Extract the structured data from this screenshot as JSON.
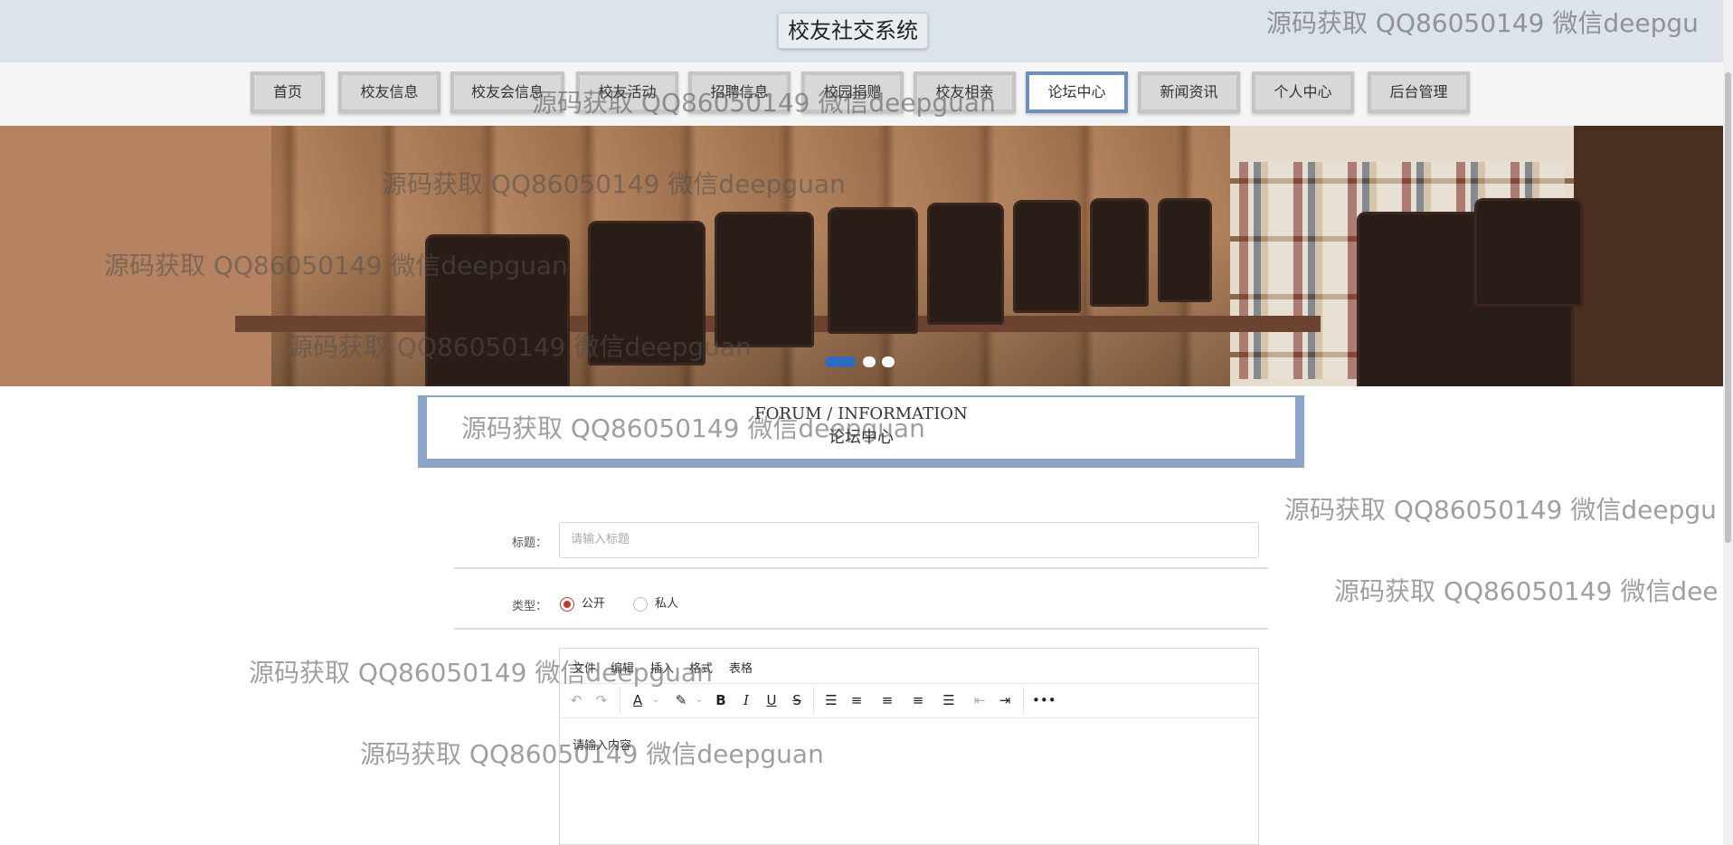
{
  "header": {
    "title": "校友社交系统"
  },
  "nav": {
    "items": [
      {
        "label": "首页"
      },
      {
        "label": "校友信息"
      },
      {
        "label": "校友会信息"
      },
      {
        "label": "校友活动"
      },
      {
        "label": "招聘信息"
      },
      {
        "label": "校园捐赠"
      },
      {
        "label": "校友相亲"
      },
      {
        "label": "论坛中心",
        "active": true
      },
      {
        "label": "新闻资讯"
      },
      {
        "label": "个人中心"
      },
      {
        "label": "后台管理"
      }
    ]
  },
  "banner": {
    "slides": 3,
    "active_slide": 1
  },
  "section": {
    "en_title": "FORUM / INFORMATION",
    "cn_title": "论坛中心"
  },
  "form": {
    "title_label": "标题：",
    "title_placeholder": "请输入标题",
    "type_label": "类型：",
    "type_options": [
      {
        "label": "公开",
        "checked": true
      },
      {
        "label": "私人",
        "checked": false
      }
    ],
    "editor": {
      "menus": [
        "文件",
        "编辑",
        "插入",
        "格式",
        "表格"
      ],
      "placeholder": "请输入内容"
    }
  },
  "watermark": {
    "text": "源码获取 QQ86050149 微信deepguan",
    "text_cut": "源码获取 QQ86050149 微信deepgu",
    "text_cut2": "源码获取 QQ86050149 微信dee"
  },
  "colors": {
    "accent": "#6f8fbf",
    "radio": "#c0392b",
    "header_bg": "#dce3ea"
  }
}
